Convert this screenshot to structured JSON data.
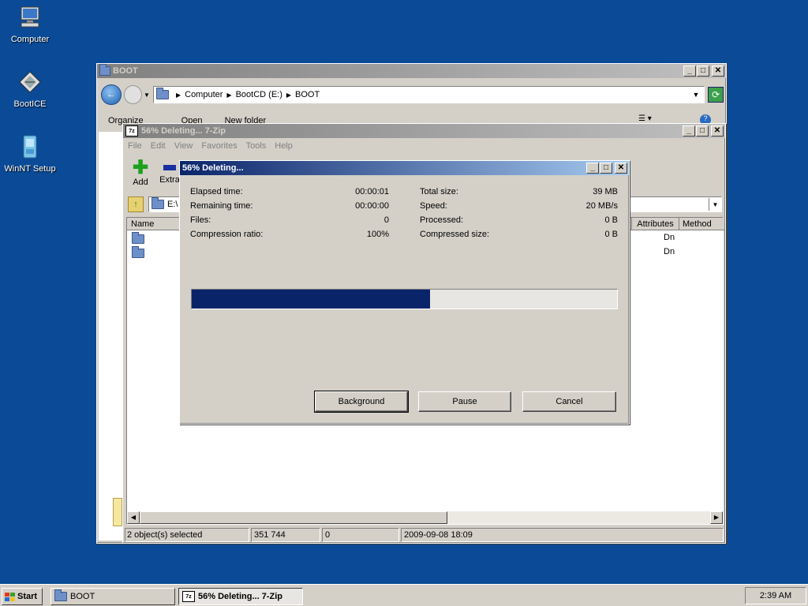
{
  "desktop": {
    "icons": [
      {
        "label": "Computer"
      },
      {
        "label": "BootICE"
      },
      {
        "label": "WinNT Setup"
      }
    ]
  },
  "explorer": {
    "title": "BOOT",
    "breadcrumb": [
      "Computer",
      "BootCD (E:)",
      "BOOT"
    ],
    "toolbar": {
      "organize": "Organize",
      "open": "Open",
      "new_folder": "New folder"
    }
  },
  "sevenzip": {
    "title": "56% Deleting... 7-Zip",
    "menu": [
      "File",
      "Edit",
      "View",
      "Favorites",
      "Tools",
      "Help"
    ],
    "toolbar": {
      "add": "Add",
      "extract": "Extra"
    },
    "path": "E:\\",
    "columns": {
      "name": "Name",
      "attributes": "Attributes",
      "method": "Method"
    },
    "rows": [
      {
        "attributes": "Dn"
      },
      {
        "attributes": "Dn"
      }
    ],
    "status": {
      "selected": "2 object(s) selected",
      "size": "351 744",
      "packed": "0",
      "modified": "2009-09-08 18:09"
    }
  },
  "progress": {
    "title": "56% Deleting...",
    "percent": 56,
    "left": [
      {
        "label": "Elapsed time:",
        "value": "00:00:01"
      },
      {
        "label": "Remaining time:",
        "value": "00:00:00"
      },
      {
        "label": "Files:",
        "value": "0"
      },
      {
        "label": "Compression ratio:",
        "value": "100%"
      }
    ],
    "right": [
      {
        "label": "Total size:",
        "value": "39 MB"
      },
      {
        "label": "Speed:",
        "value": "20 MB/s"
      },
      {
        "label": "Processed:",
        "value": "0 B"
      },
      {
        "label": "Compressed size:",
        "value": "0 B"
      }
    ],
    "buttons": {
      "background": "Background",
      "pause": "Pause",
      "cancel": "Cancel"
    }
  },
  "taskbar": {
    "start": "Start",
    "tasks": [
      {
        "label": "BOOT"
      },
      {
        "label": "56% Deleting... 7-Zip"
      }
    ],
    "clock": "2:39 AM"
  },
  "colors": {
    "desktop": "#0a4a96",
    "progress_fill": "#0a246a",
    "active_title_start": "#0a246a",
    "active_title_end": "#a6caf0"
  }
}
